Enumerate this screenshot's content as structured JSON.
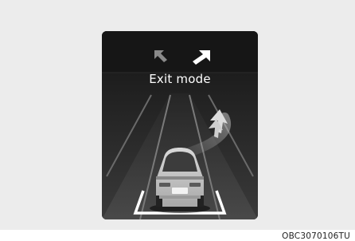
{
  "display": {
    "mode_label": "Exit mode",
    "direction_indicator": {
      "left_arrow": "arrow-up-left-icon",
      "right_arrow": "arrow-up-right-icon",
      "active": "right"
    },
    "lane_change_indicator": "lane-change-right-icon",
    "vehicle": "car-rear-icon"
  },
  "caption": "OBC3070106TU",
  "colors": {
    "panel_background": "#ececec",
    "screen_background": "#1b1b1b",
    "active_arrow": "#ffffff",
    "inactive_arrow": "#8a8a8a"
  }
}
